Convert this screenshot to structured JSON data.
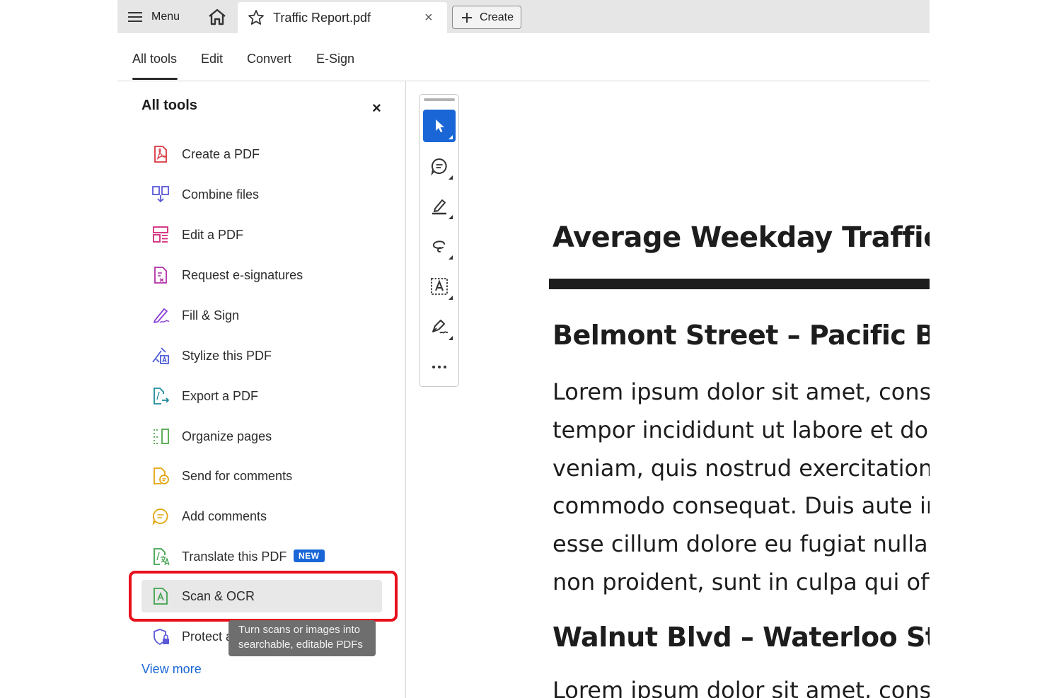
{
  "topbar": {
    "menu_label": "Menu",
    "doc_title": "Traffic Report.pdf",
    "close_glyph": "×",
    "create_label": "Create"
  },
  "subnav": {
    "tabs": [
      "All tools",
      "Edit",
      "Convert",
      "E-Sign"
    ],
    "active": "All tools"
  },
  "panel": {
    "title": "All tools",
    "close_glyph": "×",
    "items": [
      {
        "label": "Create a PDF",
        "icon": "create-pdf-icon",
        "color": "#d7373f"
      },
      {
        "label": "Combine files",
        "icon": "combine-files-icon",
        "color": "#5a58d6"
      },
      {
        "label": "Edit a PDF",
        "icon": "edit-pdf-icon",
        "color": "#d3267a"
      },
      {
        "label": "Request e-signatures",
        "icon": "request-esign-icon",
        "color": "#b02fa8"
      },
      {
        "label": "Fill & Sign",
        "icon": "fill-sign-icon",
        "color": "#8a3fd6"
      },
      {
        "label": "Stylize this PDF",
        "icon": "stylize-pdf-icon",
        "color": "#4b5bd6"
      },
      {
        "label": "Export a PDF",
        "icon": "export-pdf-icon",
        "color": "#1f8a9c"
      },
      {
        "label": "Organize pages",
        "icon": "organize-pages-icon",
        "color": "#4fa74a"
      },
      {
        "label": "Send for comments",
        "icon": "send-comments-icon",
        "color": "#e2a50d"
      },
      {
        "label": "Add comments",
        "icon": "add-comments-icon",
        "color": "#e2a50d"
      },
      {
        "label": "Translate this PDF",
        "icon": "translate-pdf-icon",
        "color": "#3fa24d",
        "badge": "NEW"
      },
      {
        "label": "Scan & OCR",
        "icon": "scan-ocr-icon",
        "color": "#3fa24d"
      },
      {
        "label": "Protect a PDF",
        "icon": "protect-pdf-icon",
        "color": "#5a58d6"
      }
    ],
    "tooltip": "Turn scans or images into searchable, editable PDFs",
    "view_more": "View more"
  },
  "toolbar": {
    "tools": [
      "select-cursor-icon",
      "add-comment-icon",
      "highlight-pen-icon",
      "draw-freehand-icon",
      "text-box-icon",
      "sign-icon",
      "more-icon"
    ],
    "active": "select-cursor-icon"
  },
  "document": {
    "h1": "Average Weekday Traffic (AWT)",
    "section1_heading": "Belmont Street – Pacific Blvd",
    "section1_lines": [
      "Lorem ipsum dolor sit amet, consectetur",
      "tempor incididunt ut labore et dolore",
      "veniam, quis nostrud exercitation",
      "commodo consequat. Duis aute irure",
      "esse cillum dolore eu fugiat nulla",
      "non proident, sunt in culpa qui officia"
    ],
    "section2_heading": "Walnut Blvd – Waterloo Street",
    "section2_line": "Lorem ipsum dolor sit amet, consectetur"
  },
  "colors": {
    "accent": "#1a66d6",
    "highlight_box": "#e8101c"
  }
}
